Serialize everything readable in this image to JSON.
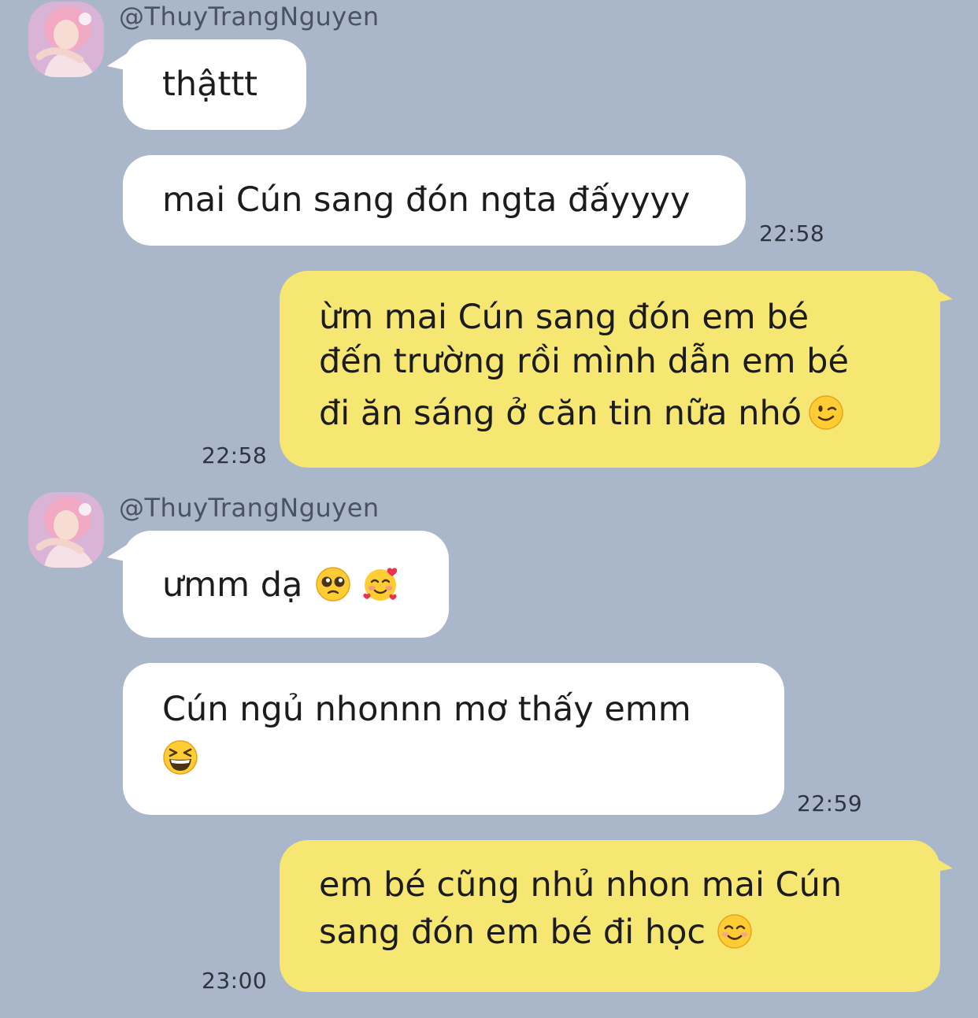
{
  "contact": {
    "handle": "@ThuyTrangNguyen"
  },
  "messages": [
    {
      "direction": "incoming",
      "lines": [
        "thậttt"
      ]
    },
    {
      "direction": "incoming",
      "lines": [
        "mai Cún sang đón ngta đấyyyy"
      ],
      "time": "22:58"
    },
    {
      "direction": "outgoing",
      "lines": [
        "ừm mai Cún sang đón em bé",
        "đến trường rồi mình dẫn em bé",
        "đi ăn sáng ở căn tin nữa nhó"
      ],
      "emoji": [
        "winking-face"
      ],
      "time": "22:58"
    },
    {
      "direction": "incoming",
      "lines": [
        "ưmm dạ"
      ],
      "emoji": [
        "pleading-face",
        "smiling-face-with-hearts"
      ]
    },
    {
      "direction": "incoming",
      "lines": [
        "Cún ngủ nhonnn mơ thấy emm"
      ],
      "emoji": [
        "grinning-squinting-face"
      ],
      "time": "22:59"
    },
    {
      "direction": "outgoing",
      "lines": [
        "em bé cũng nhủ nhon mai Cún",
        "sang đón em bé đi học"
      ],
      "emoji": [
        "smiling-face-with-smiling-eyes"
      ],
      "time": "23:00"
    }
  ],
  "colors": {
    "background": "#AAB6C9",
    "incoming_bubble": "#FFFFFF",
    "outgoing_bubble": "#F6E672"
  }
}
